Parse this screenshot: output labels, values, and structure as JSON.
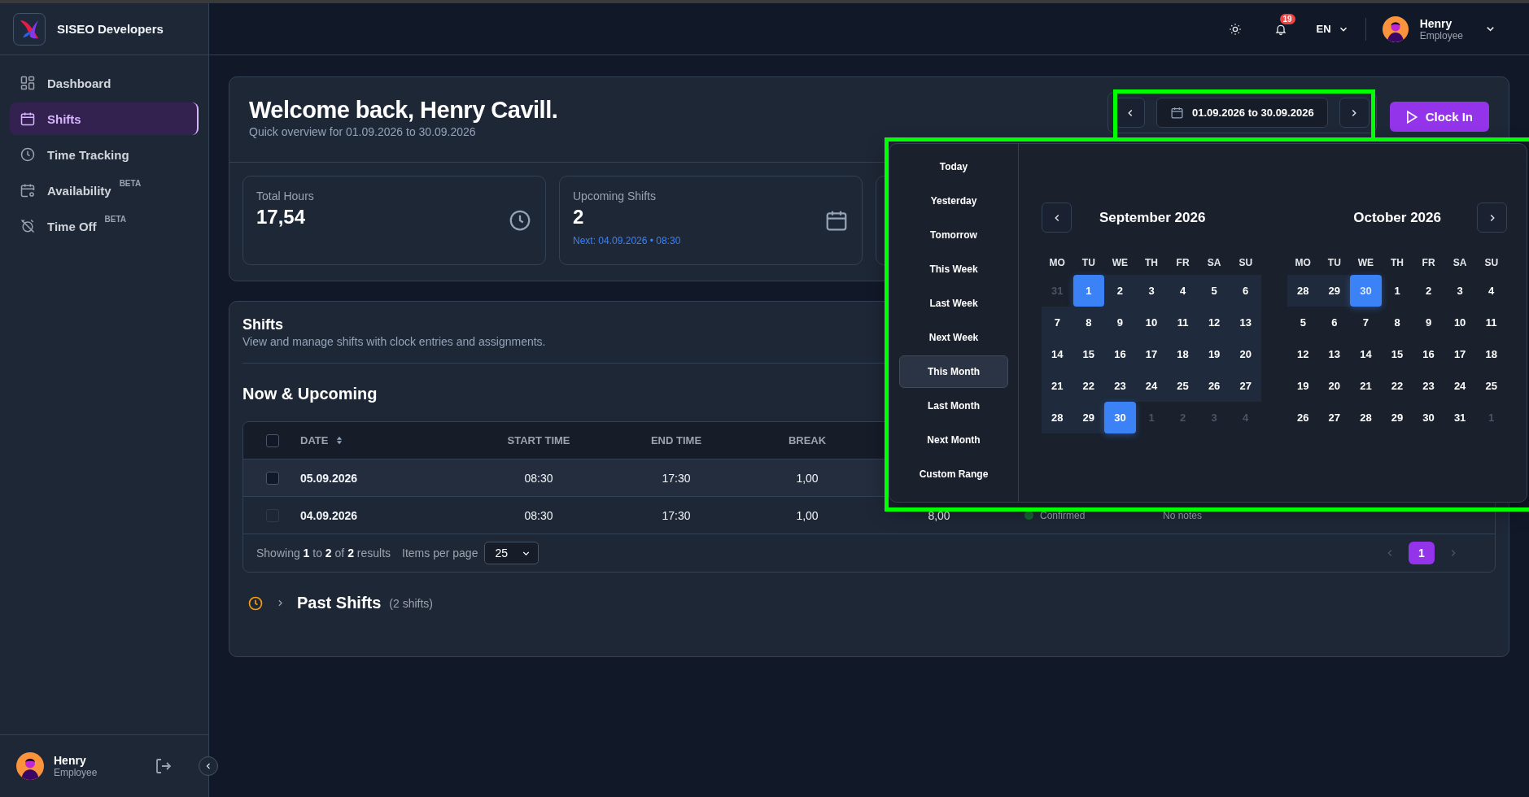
{
  "brand": {
    "name": "SISEO Developers"
  },
  "nav": [
    {
      "label": "Dashboard",
      "selected": false
    },
    {
      "label": "Shifts",
      "selected": true
    },
    {
      "label": "Time Tracking",
      "selected": false
    },
    {
      "label": "Availability",
      "selected": false,
      "badge": "BETA"
    },
    {
      "label": "Time Off",
      "selected": false,
      "badge": "BETA"
    }
  ],
  "sidebar_user": {
    "name": "Henry",
    "role": "Employee"
  },
  "topbar": {
    "notifications": "19",
    "language": "EN",
    "user": {
      "name": "Henry",
      "role": "Employee"
    }
  },
  "header": {
    "title": "Welcome back, Henry Cavill.",
    "subtitle": "Quick overview for 01.09.2026 to 30.09.2026",
    "date_range": "01.09.2026 to 30.09.2026",
    "clock_in": "Clock In"
  },
  "stats": [
    {
      "label": "Total Hours",
      "value": "17,54"
    },
    {
      "label": "Upcoming Shifts",
      "value": "2",
      "note": "Next: 04.09.2026 • 08:30"
    }
  ],
  "shifts": {
    "title": "Shifts",
    "subtitle": "View and manage shifts with clock entries and assignments.",
    "section": "Now & Upcoming",
    "all_checked": false,
    "columns": [
      "DATE",
      "START TIME",
      "END TIME",
      "BREAK"
    ],
    "rows": [
      {
        "checked": false,
        "disabled": false,
        "cells": [
          "05.09.2026",
          "08:30",
          "17:30",
          "1,00"
        ]
      },
      {
        "checked": false,
        "disabled": true,
        "cells": [
          "04.09.2026",
          "08:30",
          "17:30",
          "1,00",
          "8,00"
        ],
        "status": {
          "label": "Confirmed",
          "color": "#166534"
        },
        "notes": "No notes"
      }
    ],
    "summary": "Showing **1** to **2** of **2** results",
    "per_page_label": "Items per page",
    "per_page": "25",
    "pages": [
      {
        "label": "1",
        "selected": true
      }
    ],
    "past": {
      "title": "Past Shifts",
      "count": "(2 shifts)",
      "expanded": false
    }
  },
  "picker": {
    "presets": [
      {
        "label": "Today",
        "selected": false
      },
      {
        "label": "Yesterday",
        "selected": false
      },
      {
        "label": "Tomorrow",
        "selected": false
      },
      {
        "label": "This Week",
        "selected": false
      },
      {
        "label": "Last Week",
        "selected": false
      },
      {
        "label": "Next Week",
        "selected": false
      },
      {
        "label": "This Month",
        "selected": true
      },
      {
        "label": "Last Month",
        "selected": false
      },
      {
        "label": "Next Month",
        "selected": false
      },
      {
        "label": "Custom Range",
        "selected": false
      }
    ],
    "months": [
      {
        "title": "September 2026",
        "weekdays": [
          "MO",
          "TU",
          "WE",
          "TH",
          "FR",
          "SA",
          "SU"
        ],
        "days": [
          {
            "label": "31",
            "outside": true,
            "in_range": false,
            "endpoint": false
          },
          {
            "label": "1",
            "outside": false,
            "in_range": true,
            "endpoint": true
          },
          {
            "label": "2",
            "outside": false,
            "in_range": true,
            "endpoint": false
          },
          {
            "label": "3",
            "outside": false,
            "in_range": true,
            "endpoint": false
          },
          {
            "label": "4",
            "outside": false,
            "in_range": true,
            "endpoint": false
          },
          {
            "label": "5",
            "outside": false,
            "in_range": true,
            "endpoint": false
          },
          {
            "label": "6",
            "outside": false,
            "in_range": true,
            "endpoint": false
          },
          {
            "label": "7",
            "outside": false,
            "in_range": true,
            "endpoint": false
          },
          {
            "label": "8",
            "outside": false,
            "in_range": true,
            "endpoint": false
          },
          {
            "label": "9",
            "outside": false,
            "in_range": true,
            "endpoint": false
          },
          {
            "label": "10",
            "outside": false,
            "in_range": true,
            "endpoint": false
          },
          {
            "label": "11",
            "outside": false,
            "in_range": true,
            "endpoint": false
          },
          {
            "label": "12",
            "outside": false,
            "in_range": true,
            "endpoint": false
          },
          {
            "label": "13",
            "outside": false,
            "in_range": true,
            "endpoint": false
          },
          {
            "label": "14",
            "outside": false,
            "in_range": true,
            "endpoint": false
          },
          {
            "label": "15",
            "outside": false,
            "in_range": true,
            "endpoint": false
          },
          {
            "label": "16",
            "outside": false,
            "in_range": true,
            "endpoint": false
          },
          {
            "label": "17",
            "outside": false,
            "in_range": true,
            "endpoint": false
          },
          {
            "label": "18",
            "outside": false,
            "in_range": true,
            "endpoint": false
          },
          {
            "label": "19",
            "outside": false,
            "in_range": true,
            "endpoint": false
          },
          {
            "label": "20",
            "outside": false,
            "in_range": true,
            "endpoint": false
          },
          {
            "label": "21",
            "outside": false,
            "in_range": true,
            "endpoint": false
          },
          {
            "label": "22",
            "outside": false,
            "in_range": true,
            "endpoint": false
          },
          {
            "label": "23",
            "outside": false,
            "in_range": true,
            "endpoint": false
          },
          {
            "label": "24",
            "outside": false,
            "in_range": true,
            "endpoint": false
          },
          {
            "label": "25",
            "outside": false,
            "in_range": true,
            "endpoint": false
          },
          {
            "label": "26",
            "outside": false,
            "in_range": true,
            "endpoint": false
          },
          {
            "label": "27",
            "outside": false,
            "in_range": true,
            "endpoint": false
          },
          {
            "label": "28",
            "outside": false,
            "in_range": true,
            "endpoint": false
          },
          {
            "label": "29",
            "outside": false,
            "in_range": true,
            "endpoint": false
          },
          {
            "label": "30",
            "outside": false,
            "in_range": true,
            "endpoint": true
          },
          {
            "label": "1",
            "outside": true,
            "in_range": false,
            "endpoint": false
          },
          {
            "label": "2",
            "outside": true,
            "in_range": false,
            "endpoint": false
          },
          {
            "label": "3",
            "outside": true,
            "in_range": false,
            "endpoint": false
          },
          {
            "label": "4",
            "outside": true,
            "in_range": false,
            "endpoint": false
          }
        ]
      },
      {
        "title": "October 2026",
        "weekdays": [
          "MO",
          "TU",
          "WE",
          "TH",
          "FR",
          "SA",
          "SU"
        ],
        "days": [
          {
            "label": "28",
            "outside": true,
            "in_range": true,
            "endpoint": false
          },
          {
            "label": "29",
            "outside": true,
            "in_range": true,
            "endpoint": false
          },
          {
            "label": "30",
            "outside": true,
            "in_range": true,
            "endpoint": true
          },
          {
            "label": "1",
            "outside": false,
            "in_range": false,
            "endpoint": false
          },
          {
            "label": "2",
            "outside": false,
            "in_range": false,
            "endpoint": false
          },
          {
            "label": "3",
            "outside": false,
            "in_range": false,
            "endpoint": false
          },
          {
            "label": "4",
            "outside": false,
            "in_range": false,
            "endpoint": false
          },
          {
            "label": "5",
            "outside": false,
            "in_range": false,
            "endpoint": false
          },
          {
            "label": "6",
            "outside": false,
            "in_range": false,
            "endpoint": false
          },
          {
            "label": "7",
            "outside": false,
            "in_range": false,
            "endpoint": false
          },
          {
            "label": "8",
            "outside": false,
            "in_range": false,
            "endpoint": false
          },
          {
            "label": "9",
            "outside": false,
            "in_range": false,
            "endpoint": false
          },
          {
            "label": "10",
            "outside": false,
            "in_range": false,
            "endpoint": false
          },
          {
            "label": "11",
            "outside": false,
            "in_range": false,
            "endpoint": false
          },
          {
            "label": "12",
            "outside": false,
            "in_range": false,
            "endpoint": false
          },
          {
            "label": "13",
            "outside": false,
            "in_range": false,
            "endpoint": false
          },
          {
            "label": "14",
            "outside": false,
            "in_range": false,
            "endpoint": false
          },
          {
            "label": "15",
            "outside": false,
            "in_range": false,
            "endpoint": false
          },
          {
            "label": "16",
            "outside": false,
            "in_range": false,
            "endpoint": false
          },
          {
            "label": "17",
            "outside": false,
            "in_range": false,
            "endpoint": false
          },
          {
            "label": "18",
            "outside": false,
            "in_range": false,
            "endpoint": false
          },
          {
            "label": "19",
            "outside": false,
            "in_range": false,
            "endpoint": false
          },
          {
            "label": "20",
            "outside": false,
            "in_range": false,
            "endpoint": false
          },
          {
            "label": "21",
            "outside": false,
            "in_range": false,
            "endpoint": false
          },
          {
            "label": "22",
            "outside": false,
            "in_range": false,
            "endpoint": false
          },
          {
            "label": "23",
            "outside": false,
            "in_range": false,
            "endpoint": false
          },
          {
            "label": "24",
            "outside": false,
            "in_range": false,
            "endpoint": false
          },
          {
            "label": "25",
            "outside": false,
            "in_range": false,
            "endpoint": false
          },
          {
            "label": "26",
            "outside": false,
            "in_range": false,
            "endpoint": false
          },
          {
            "label": "27",
            "outside": false,
            "in_range": false,
            "endpoint": false
          },
          {
            "label": "28",
            "outside": false,
            "in_range": false,
            "endpoint": false
          },
          {
            "label": "29",
            "outside": false,
            "in_range": false,
            "endpoint": false
          },
          {
            "label": "30",
            "outside": false,
            "in_range": false,
            "endpoint": false
          },
          {
            "label": "31",
            "outside": false,
            "in_range": false,
            "endpoint": false
          },
          {
            "label": "1",
            "outside": true,
            "in_range": false,
            "endpoint": false
          }
        ]
      }
    ]
  }
}
